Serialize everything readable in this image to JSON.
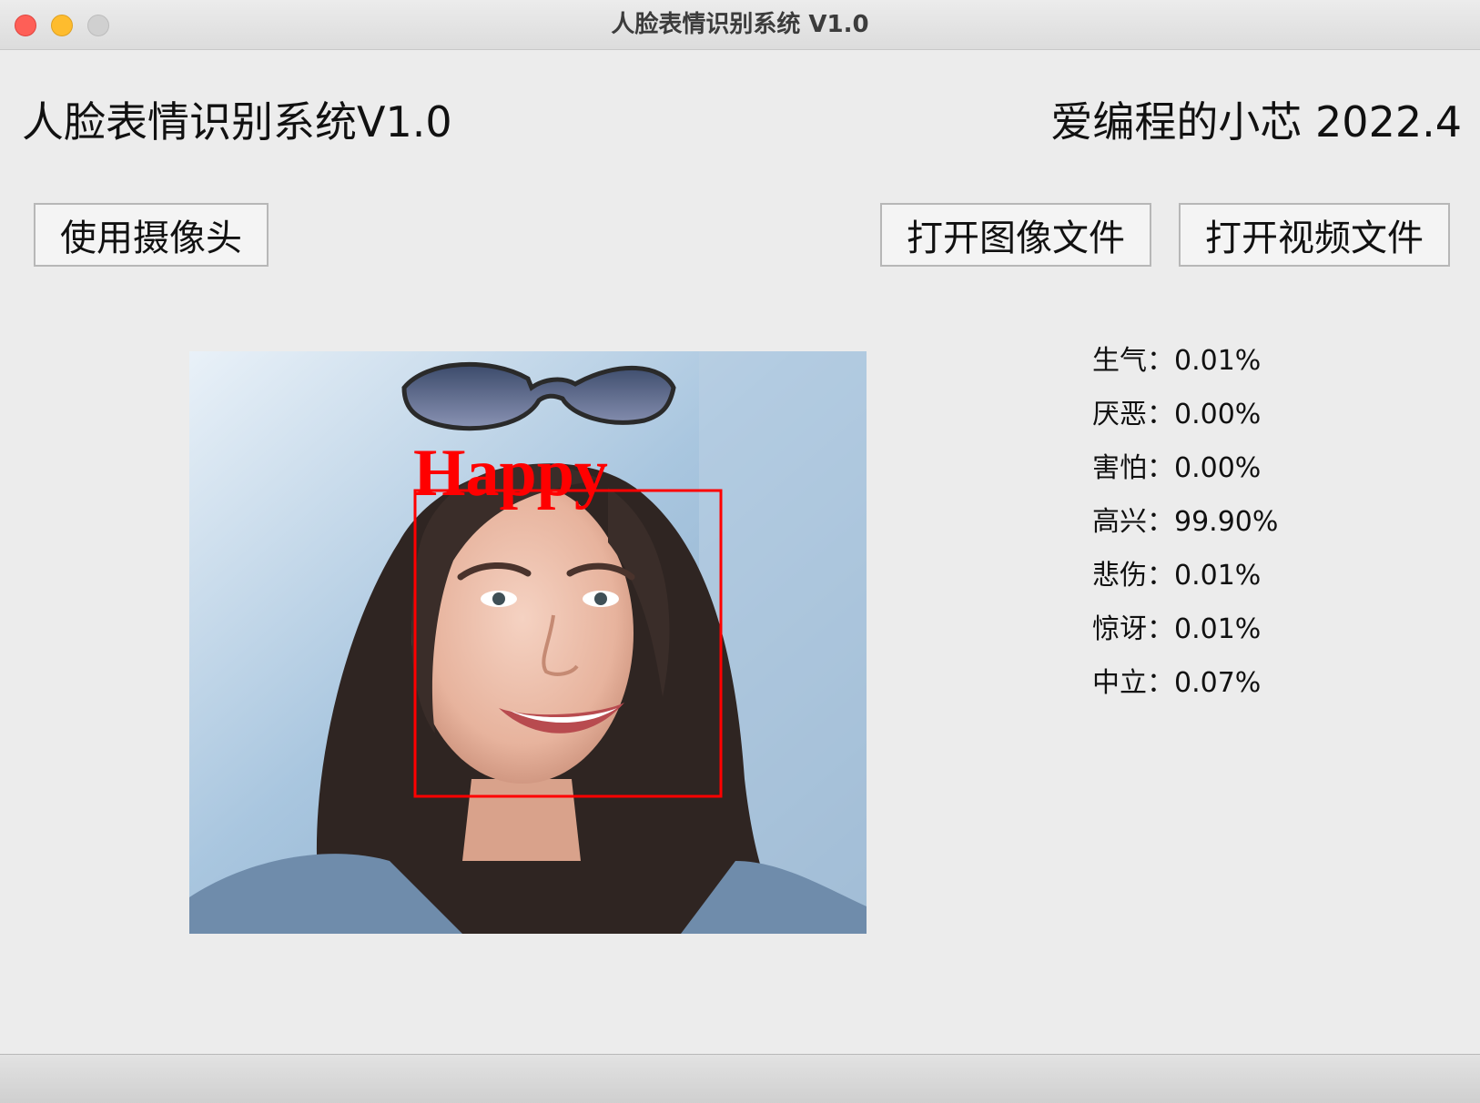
{
  "window": {
    "title": "人脸表情识别系统 V1.0"
  },
  "header": {
    "app_title": "人脸表情识别系统V1.0",
    "author_date": "爱编程的小芯 2022.4"
  },
  "buttons": {
    "camera": "使用摄像头",
    "open_image": "打开图像文件",
    "open_video": "打开视频文件"
  },
  "detection": {
    "label": "Happy",
    "box_color": "#ff0000"
  },
  "results": [
    {
      "label": "生气：",
      "value": "0.01%"
    },
    {
      "label": "厌恶：",
      "value": "0.00%"
    },
    {
      "label": "害怕：",
      "value": "0.00%"
    },
    {
      "label": "高兴：",
      "value": "99.90%"
    },
    {
      "label": "悲伤：",
      "value": "0.01%"
    },
    {
      "label": "惊讶：",
      "value": "0.01%"
    },
    {
      "label": "中立：",
      "value": "0.07%"
    }
  ]
}
